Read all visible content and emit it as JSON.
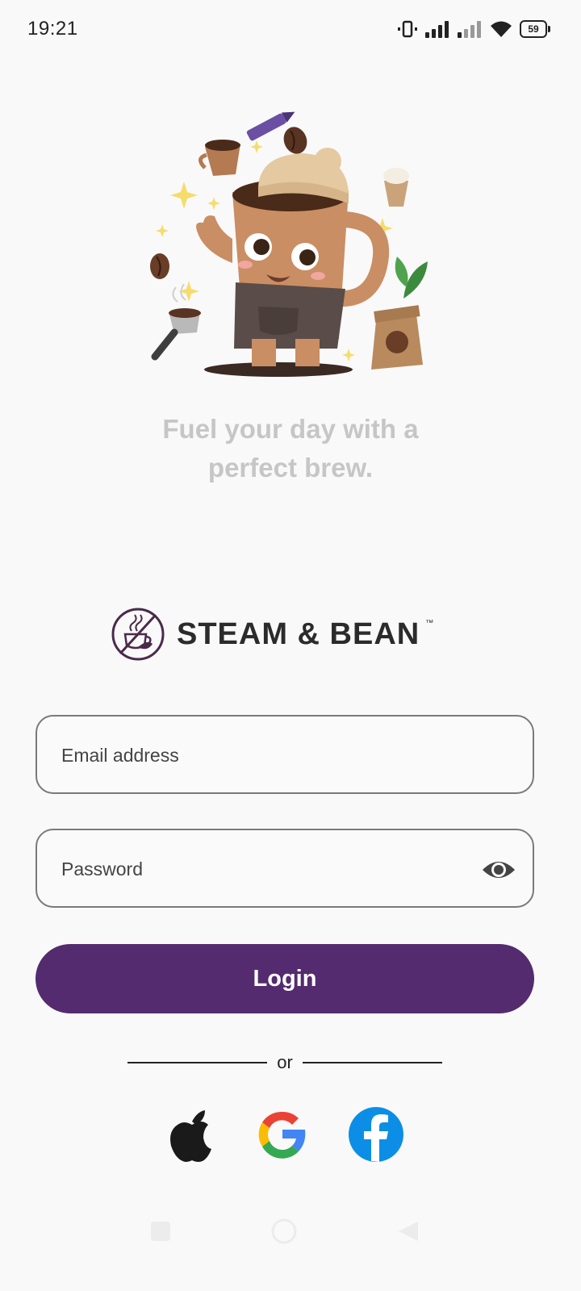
{
  "status_bar": {
    "time": "19:21",
    "battery_level": "59"
  },
  "hero": {
    "tagline_line1": "Fuel your day with a",
    "tagline_line2": "perfect brew."
  },
  "brand": {
    "name": "STEAM & BEAN",
    "trademark": "™",
    "accent_color": "#542b6e"
  },
  "login_form": {
    "email_placeholder": "Email address",
    "email_value": "",
    "password_placeholder": "Password",
    "password_value": "",
    "login_label": "Login"
  },
  "divider": {
    "text": "or"
  },
  "social_logins": [
    "apple-icon",
    "google-icon",
    "facebook-icon"
  ]
}
